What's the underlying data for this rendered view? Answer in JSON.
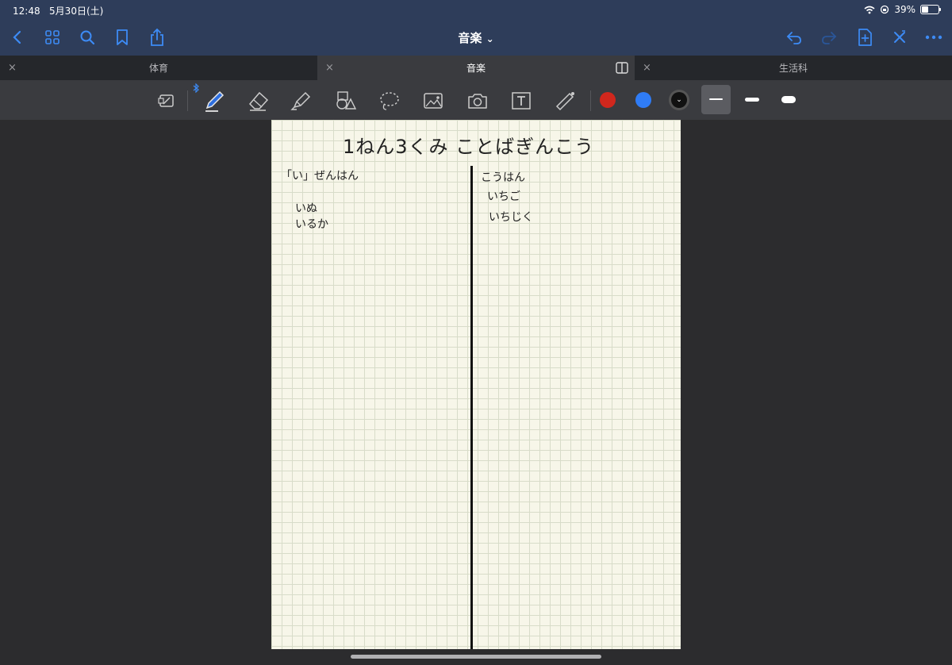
{
  "status": {
    "time": "12:48",
    "date": "5月30日(土)",
    "battery_percent": "39%",
    "battery_level": 0.39
  },
  "nav": {
    "title": "音楽",
    "title_dropdown": "⌄",
    "left_icons": [
      "back-icon",
      "grid-icon",
      "search-icon",
      "bookmark-icon",
      "share-icon"
    ],
    "right_icons": [
      "undo-icon",
      "redo-icon",
      "add-page-icon",
      "close-tool-icon",
      "more-icon"
    ]
  },
  "tabs": [
    {
      "label": "体育",
      "close": "×",
      "active": false
    },
    {
      "label": "音楽",
      "close": "×",
      "active": true
    },
    {
      "label": "生活科",
      "close": "×",
      "active": false
    }
  ],
  "toolbar": {
    "tools": [
      "read-only-icon",
      "pen-icon",
      "eraser-icon",
      "highlighter-icon",
      "shapes-icon",
      "lasso-icon",
      "image-icon",
      "camera-icon",
      "text-icon",
      "laser-icon"
    ],
    "colors": [
      "#d0271d",
      "#2f7cf6",
      "#111111"
    ],
    "selected_color_chevron": "⌄",
    "stroke_widths": [
      "thin",
      "medium",
      "thick"
    ]
  },
  "note": {
    "title": "1ねん3くみ ことばぎんこう",
    "left_heading": "「い」ぜんはん",
    "left_words": [
      "いぬ",
      "いるか"
    ],
    "right_heading": "こうはん",
    "right_words": [
      "いちご",
      "いちじく"
    ]
  }
}
